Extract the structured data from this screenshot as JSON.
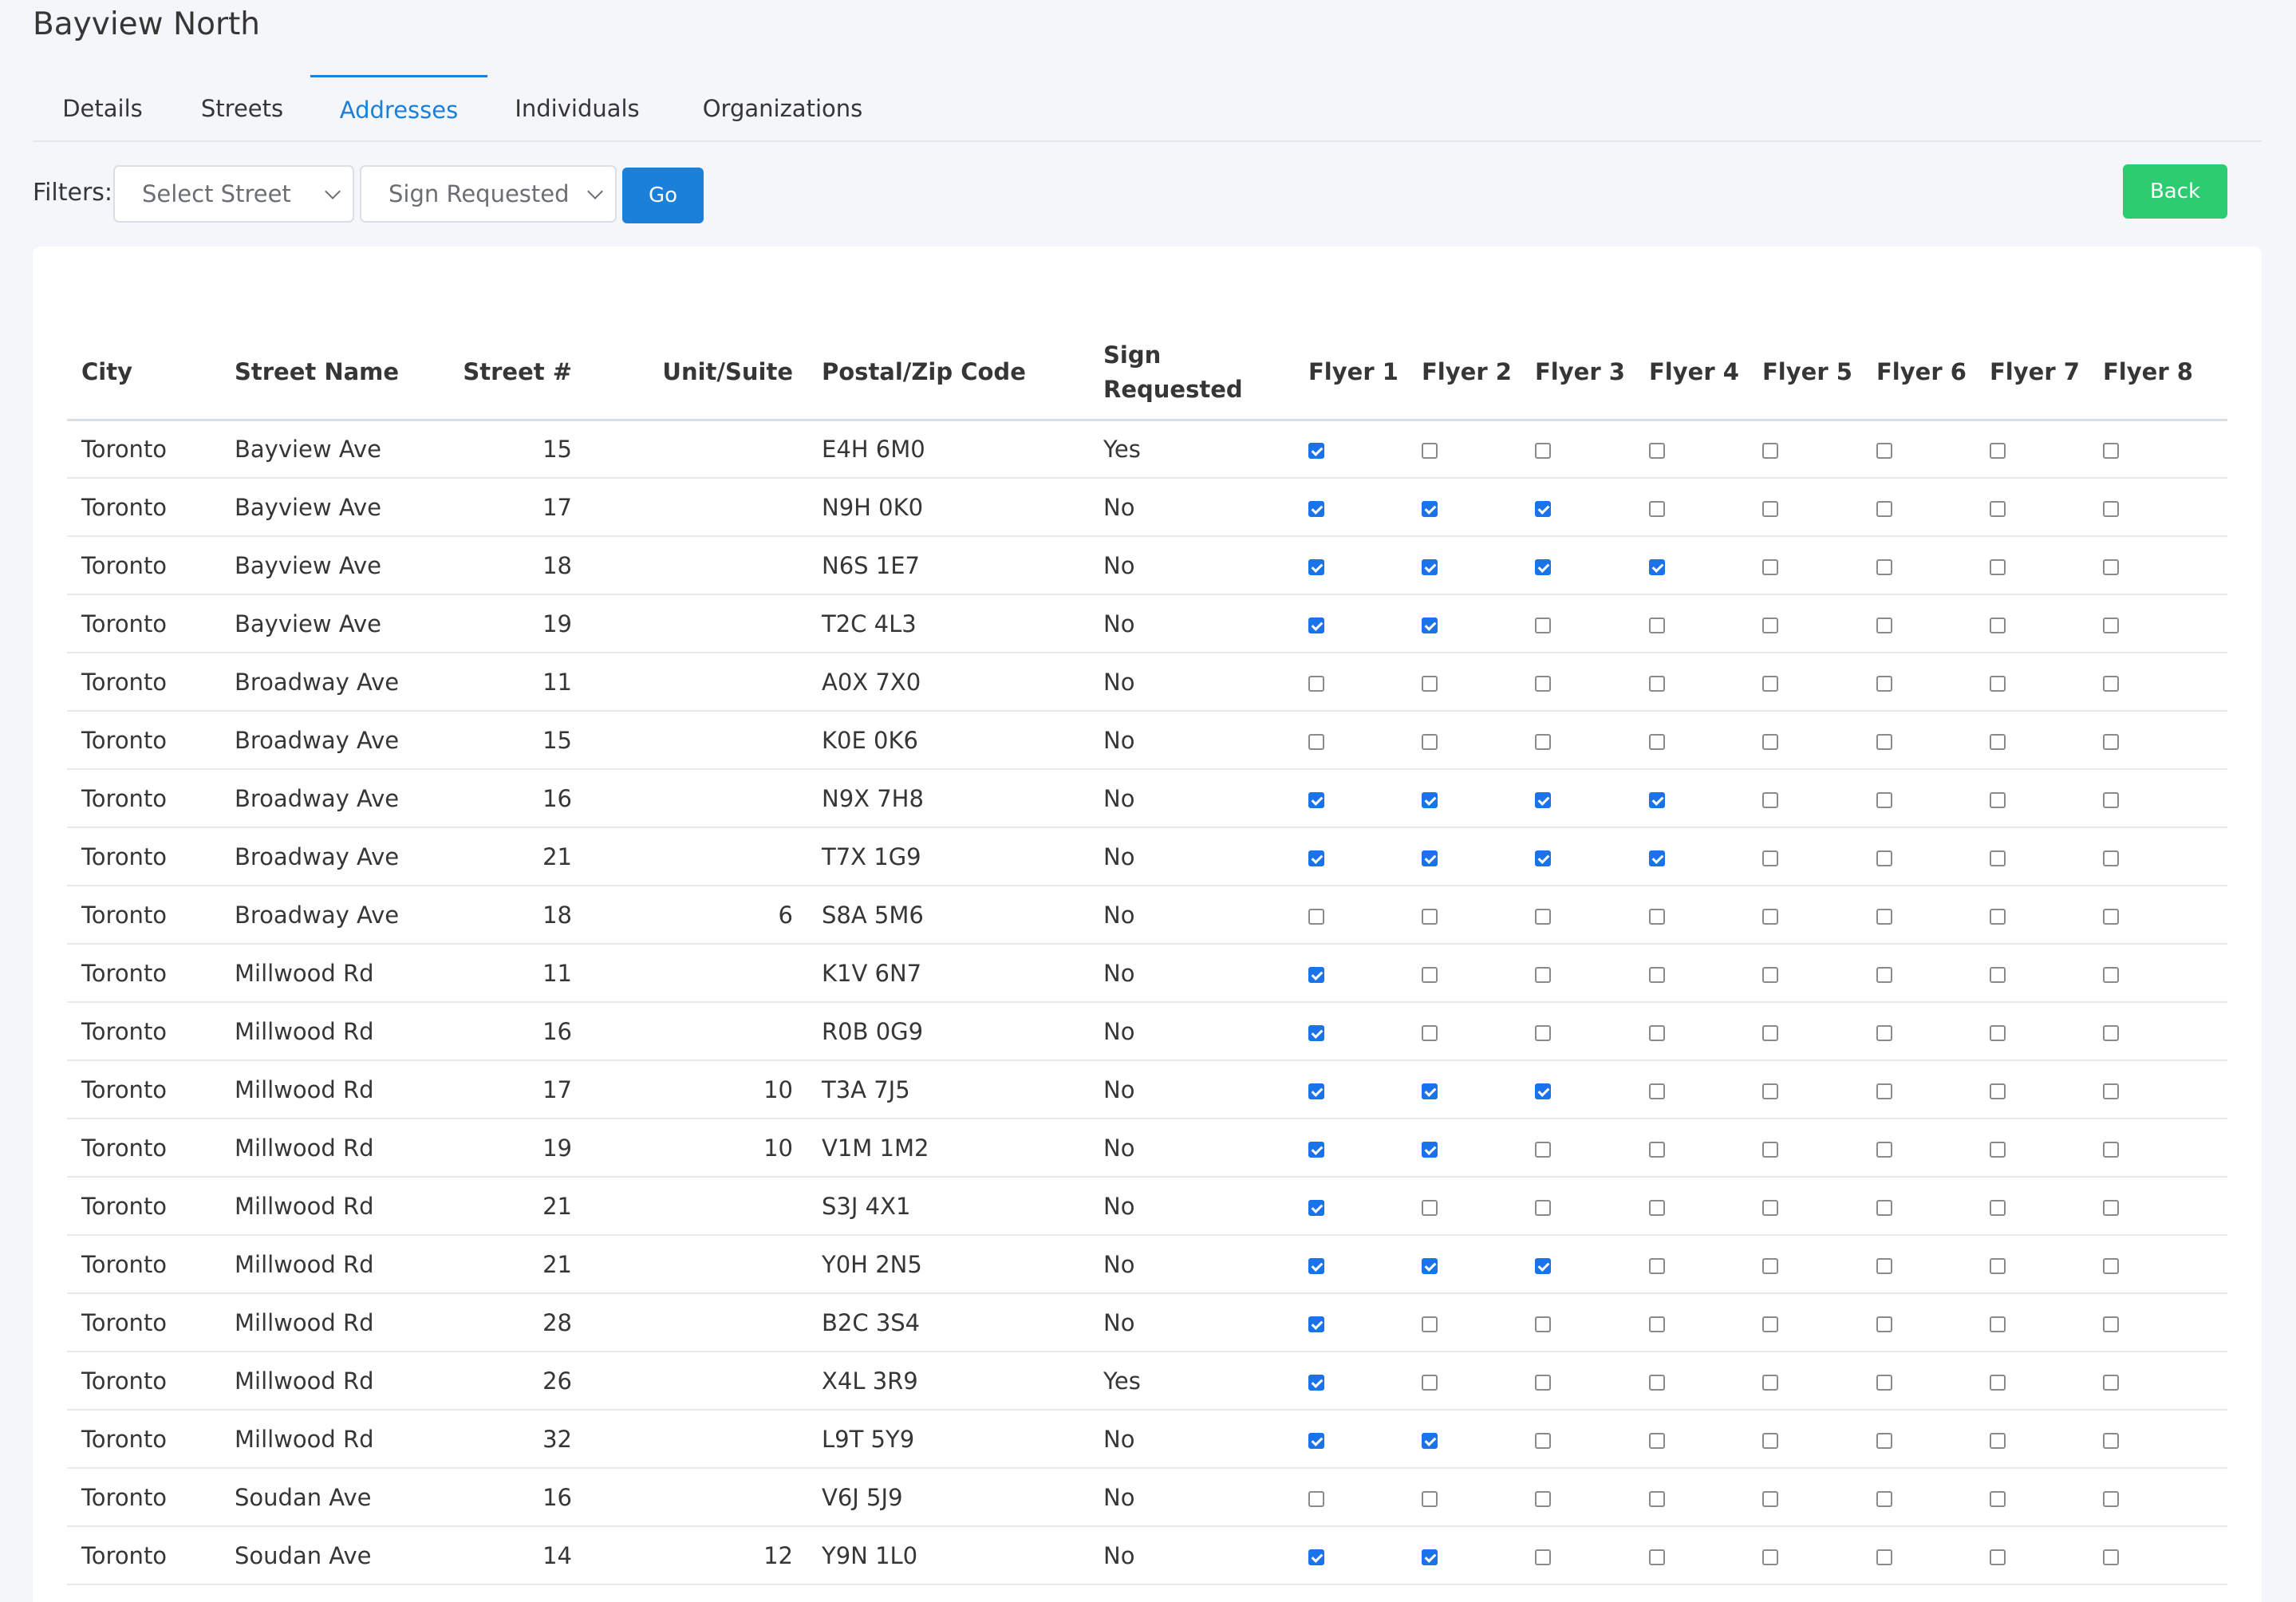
{
  "page": {
    "title": "Bayview North"
  },
  "tabs": [
    {
      "label": "Details"
    },
    {
      "label": "Streets"
    },
    {
      "label": "Addresses",
      "active": true
    },
    {
      "label": "Individuals"
    },
    {
      "label": "Organizations"
    }
  ],
  "filters": {
    "label": "Filters:",
    "street_select": "Select Street",
    "sign_select": "Sign Requested",
    "go_label": "Go"
  },
  "back_label": "Back",
  "colors": {
    "accent": "#1a80d9",
    "back": "#2ecc71",
    "checkbox": "#1a73e8"
  },
  "table": {
    "headers": {
      "city": "City",
      "street_name": "Street Name",
      "street_num": "Street #",
      "unit": "Unit/Suite",
      "postal": "Postal/Zip Code",
      "sign": "Sign Requested",
      "flyers": [
        "Flyer 1",
        "Flyer 2",
        "Flyer 3",
        "Flyer 4",
        "Flyer 5",
        "Flyer 6",
        "Flyer 7",
        "Flyer 8"
      ]
    },
    "rows": [
      {
        "city": "Toronto",
        "street": "Bayview Ave",
        "num": "15",
        "unit": "",
        "postal": "E4H 6M0",
        "sign": "Yes",
        "flyers": [
          1,
          0,
          0,
          0,
          0,
          0,
          0,
          0
        ]
      },
      {
        "city": "Toronto",
        "street": "Bayview Ave",
        "num": "17",
        "unit": "",
        "postal": "N9H 0K0",
        "sign": "No",
        "flyers": [
          1,
          1,
          1,
          0,
          0,
          0,
          0,
          0
        ]
      },
      {
        "city": "Toronto",
        "street": "Bayview Ave",
        "num": "18",
        "unit": "",
        "postal": "N6S 1E7",
        "sign": "No",
        "flyers": [
          1,
          1,
          1,
          1,
          0,
          0,
          0,
          0
        ]
      },
      {
        "city": "Toronto",
        "street": "Bayview Ave",
        "num": "19",
        "unit": "",
        "postal": "T2C 4L3",
        "sign": "No",
        "flyers": [
          1,
          1,
          0,
          0,
          0,
          0,
          0,
          0
        ]
      },
      {
        "city": "Toronto",
        "street": "Broadway Ave",
        "num": "11",
        "unit": "",
        "postal": "A0X 7X0",
        "sign": "No",
        "flyers": [
          0,
          0,
          0,
          0,
          0,
          0,
          0,
          0
        ]
      },
      {
        "city": "Toronto",
        "street": "Broadway Ave",
        "num": "15",
        "unit": "",
        "postal": "K0E 0K6",
        "sign": "No",
        "flyers": [
          0,
          0,
          0,
          0,
          0,
          0,
          0,
          0
        ]
      },
      {
        "city": "Toronto",
        "street": "Broadway Ave",
        "num": "16",
        "unit": "",
        "postal": "N9X 7H8",
        "sign": "No",
        "flyers": [
          1,
          1,
          1,
          1,
          0,
          0,
          0,
          0
        ]
      },
      {
        "city": "Toronto",
        "street": "Broadway Ave",
        "num": "21",
        "unit": "",
        "postal": "T7X 1G9",
        "sign": "No",
        "flyers": [
          1,
          1,
          1,
          1,
          0,
          0,
          0,
          0
        ]
      },
      {
        "city": "Toronto",
        "street": "Broadway Ave",
        "num": "18",
        "unit": "6",
        "postal": "S8A 5M6",
        "sign": "No",
        "flyers": [
          0,
          0,
          0,
          0,
          0,
          0,
          0,
          0
        ]
      },
      {
        "city": "Toronto",
        "street": "Millwood Rd",
        "num": "11",
        "unit": "",
        "postal": "K1V 6N7",
        "sign": "No",
        "flyers": [
          1,
          0,
          0,
          0,
          0,
          0,
          0,
          0
        ]
      },
      {
        "city": "Toronto",
        "street": "Millwood Rd",
        "num": "16",
        "unit": "",
        "postal": "R0B 0G9",
        "sign": "No",
        "flyers": [
          1,
          0,
          0,
          0,
          0,
          0,
          0,
          0
        ]
      },
      {
        "city": "Toronto",
        "street": "Millwood Rd",
        "num": "17",
        "unit": "10",
        "postal": "T3A 7J5",
        "sign": "No",
        "flyers": [
          1,
          1,
          1,
          0,
          0,
          0,
          0,
          0
        ]
      },
      {
        "city": "Toronto",
        "street": "Millwood Rd",
        "num": "19",
        "unit": "10",
        "postal": "V1M 1M2",
        "sign": "No",
        "flyers": [
          1,
          1,
          0,
          0,
          0,
          0,
          0,
          0
        ]
      },
      {
        "city": "Toronto",
        "street": "Millwood Rd",
        "num": "21",
        "unit": "",
        "postal": "S3J 4X1",
        "sign": "No",
        "flyers": [
          1,
          0,
          0,
          0,
          0,
          0,
          0,
          0
        ]
      },
      {
        "city": "Toronto",
        "street": "Millwood Rd",
        "num": "21",
        "unit": "",
        "postal": "Y0H 2N5",
        "sign": "No",
        "flyers": [
          1,
          1,
          1,
          0,
          0,
          0,
          0,
          0
        ]
      },
      {
        "city": "Toronto",
        "street": "Millwood Rd",
        "num": "28",
        "unit": "",
        "postal": "B2C 3S4",
        "sign": "No",
        "flyers": [
          1,
          0,
          0,
          0,
          0,
          0,
          0,
          0
        ]
      },
      {
        "city": "Toronto",
        "street": "Millwood Rd",
        "num": "26",
        "unit": "",
        "postal": "X4L 3R9",
        "sign": "Yes",
        "flyers": [
          1,
          0,
          0,
          0,
          0,
          0,
          0,
          0
        ]
      },
      {
        "city": "Toronto",
        "street": "Millwood Rd",
        "num": "32",
        "unit": "",
        "postal": "L9T 5Y9",
        "sign": "No",
        "flyers": [
          1,
          1,
          0,
          0,
          0,
          0,
          0,
          0
        ]
      },
      {
        "city": "Toronto",
        "street": "Soudan Ave",
        "num": "16",
        "unit": "",
        "postal": "V6J 5J9",
        "sign": "No",
        "flyers": [
          0,
          0,
          0,
          0,
          0,
          0,
          0,
          0
        ]
      },
      {
        "city": "Toronto",
        "street": "Soudan Ave",
        "num": "14",
        "unit": "12",
        "postal": "Y9N 1L0",
        "sign": "No",
        "flyers": [
          1,
          1,
          0,
          0,
          0,
          0,
          0,
          0
        ]
      }
    ]
  }
}
